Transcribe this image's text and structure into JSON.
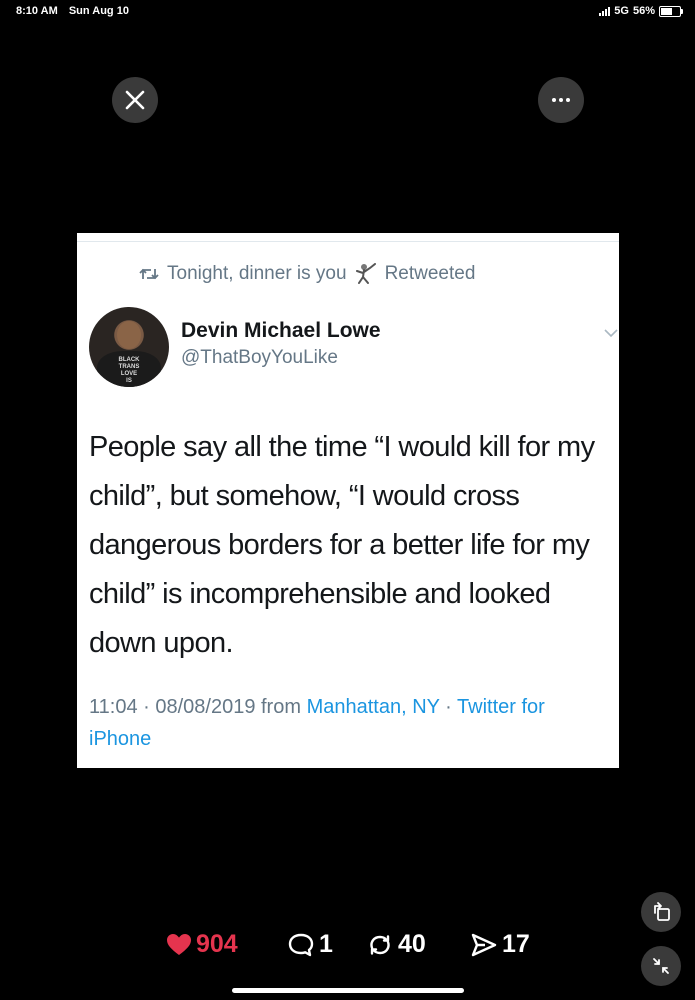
{
  "status_bar": {
    "time": "8:10 AM",
    "date": "Sun Aug 10",
    "network": "5G",
    "battery": "56%"
  },
  "controls": {
    "close_icon": "close-icon",
    "more_icon": "more-icon"
  },
  "tweet": {
    "retweet_text": "Tonight, dinner is you",
    "retweet_suffix": "Retweeted",
    "author_name": "Devin Michael Lowe",
    "author_handle": "@ThatBoyYouLike",
    "body": "People say all the time “I would kill for my child”, but somehow, “I would cross dangerous borders for a better life for my child” is incomprehensible and looked down upon.",
    "time": "11:04 · 08/08/2019 from ",
    "location": "Manhattan, NY",
    "separator": " · ",
    "source": "Twitter for iPhone"
  },
  "stats": {
    "likes": "904",
    "replies": "1",
    "reposts": "40",
    "shares": "17"
  },
  "colors": {
    "like": "#e5344e",
    "link": "#1b95e0",
    "muted": "#657786"
  }
}
